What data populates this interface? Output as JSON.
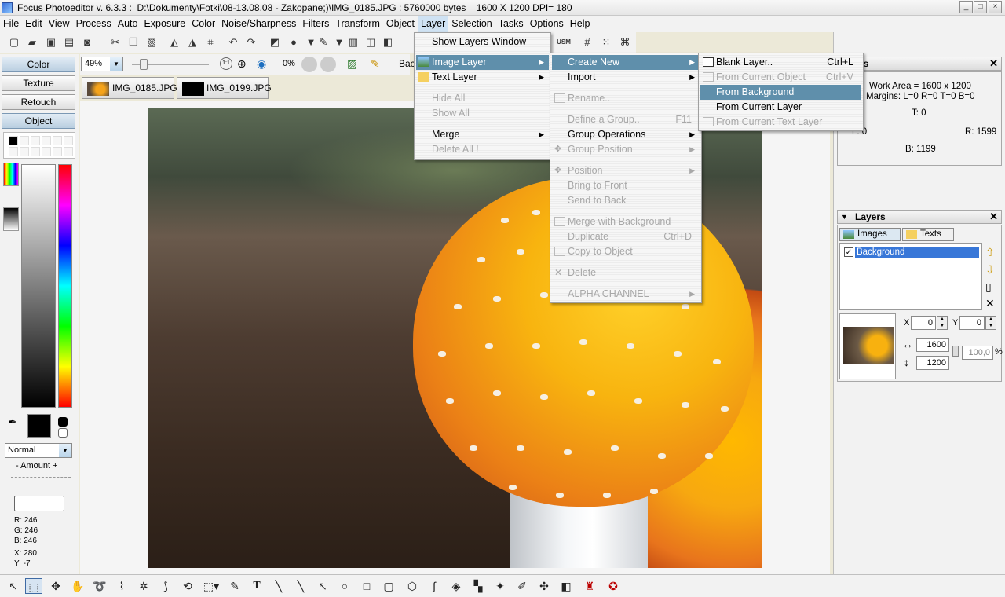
{
  "window": {
    "title": "Focus Photoeditor v. 6.3.3 :  D:\\Dokumenty\\Fotki\\08-13.08.08 - Zakopane;)\\IMG_0185.JPG : 5760000 bytes    1600 X 1200 DPI= 180",
    "min": "_",
    "max": "□",
    "close": "×"
  },
  "menubar": [
    "File",
    "Edit",
    "View",
    "Process",
    "Auto",
    "Exposure",
    "Color",
    "Noise/Sharpness",
    "Filters",
    "Transform",
    "Object",
    "Layer",
    "Selection",
    "Tasks",
    "Options",
    "Help"
  ],
  "toolbar2": {
    "zoom": "49%",
    "zoom_arrow": "▼",
    "percent": "0%",
    "bac": "Bac"
  },
  "tabs": [
    "IMG_0185.JPG",
    "IMG_0199.JPG"
  ],
  "left_panel": {
    "buttons": [
      "Color",
      "Texture",
      "Retouch",
      "Object"
    ],
    "blend_mode": "Normal",
    "amount_label": "- Amount +",
    "readout": {
      "r": "R: 246",
      "g": "G: 246",
      "b": "B: 246",
      "x": "X: 280",
      "y": "Y: -7"
    }
  },
  "layer_menu": [
    {
      "label": "Show Layers Window",
      "state": "normal"
    },
    {
      "label": "Image Layer",
      "state": "highlight",
      "submenu": true
    },
    {
      "label": "Text Layer",
      "state": "normal",
      "submenu": true
    },
    {
      "label": "Hide All",
      "state": "disabled"
    },
    {
      "label": "Show All",
      "state": "disabled"
    },
    {
      "label": "Merge",
      "state": "normal",
      "submenu": true
    },
    {
      "label": "Delete All !",
      "state": "disabled"
    }
  ],
  "image_layer_menu": [
    {
      "label": "Create New",
      "state": "highlight",
      "submenu": true,
      "shortcut": ""
    },
    {
      "label": "Import",
      "state": "normal",
      "submenu": true,
      "shortcut": ""
    },
    {
      "label": "Rename..",
      "state": "disabled",
      "shortcut": ""
    },
    {
      "label": "Define a Group..",
      "state": "disabled",
      "shortcut": "F11"
    },
    {
      "label": "Group Operations",
      "state": "normal",
      "submenu": true,
      "shortcut": ""
    },
    {
      "label": "Group Position",
      "state": "disabled",
      "submenu": true,
      "shortcut": ""
    },
    {
      "label": "Position",
      "state": "disabled",
      "submenu": true,
      "shortcut": ""
    },
    {
      "label": "Bring to Front",
      "state": "disabled",
      "shortcut": ""
    },
    {
      "label": "Send to Back",
      "state": "disabled",
      "shortcut": ""
    },
    {
      "label": "Merge with Background",
      "state": "disabled",
      "shortcut": ""
    },
    {
      "label": "Duplicate",
      "state": "disabled",
      "shortcut": "Ctrl+D"
    },
    {
      "label": "Copy to Object",
      "state": "disabled",
      "shortcut": ""
    },
    {
      "label": "Delete",
      "state": "disabled",
      "shortcut": ""
    },
    {
      "label": "ALPHA CHANNEL",
      "state": "disabled",
      "submenu": true,
      "shortcut": ""
    }
  ],
  "create_new_menu": [
    {
      "label": "Blank Layer..",
      "state": "normal",
      "shortcut": "Ctrl+L"
    },
    {
      "label": "From Current Object",
      "state": "disabled",
      "shortcut": "Ctrl+V"
    },
    {
      "label": "From Background",
      "state": "highlight",
      "shortcut": ""
    },
    {
      "label": "From Current Layer",
      "state": "normal",
      "shortcut": ""
    },
    {
      "label": "From Current Text Layer",
      "state": "disabled",
      "shortcut": ""
    }
  ],
  "info_panel": {
    "title": "ols",
    "work_area": "Work Area = 1600 x 1200",
    "margins": "Margins: L=0 R=0 T=0 B=0",
    "t": "T: 0",
    "l": "L: 0",
    "r": "R: 1599",
    "b": "B: 1199"
  },
  "layers_panel": {
    "title": "Layers",
    "tabs": [
      "Images",
      "Texts"
    ],
    "items": [
      {
        "name": "Background",
        "checked": true
      }
    ],
    "x_label": "X",
    "x_value": "0",
    "y_label": "Y",
    "y_value": "0",
    "width": "1600",
    "height": "1200",
    "scale": "100,0",
    "percent": "%"
  },
  "colors": {
    "menu_highlight": "#5f8fab",
    "accent": "#3a6fd8"
  }
}
